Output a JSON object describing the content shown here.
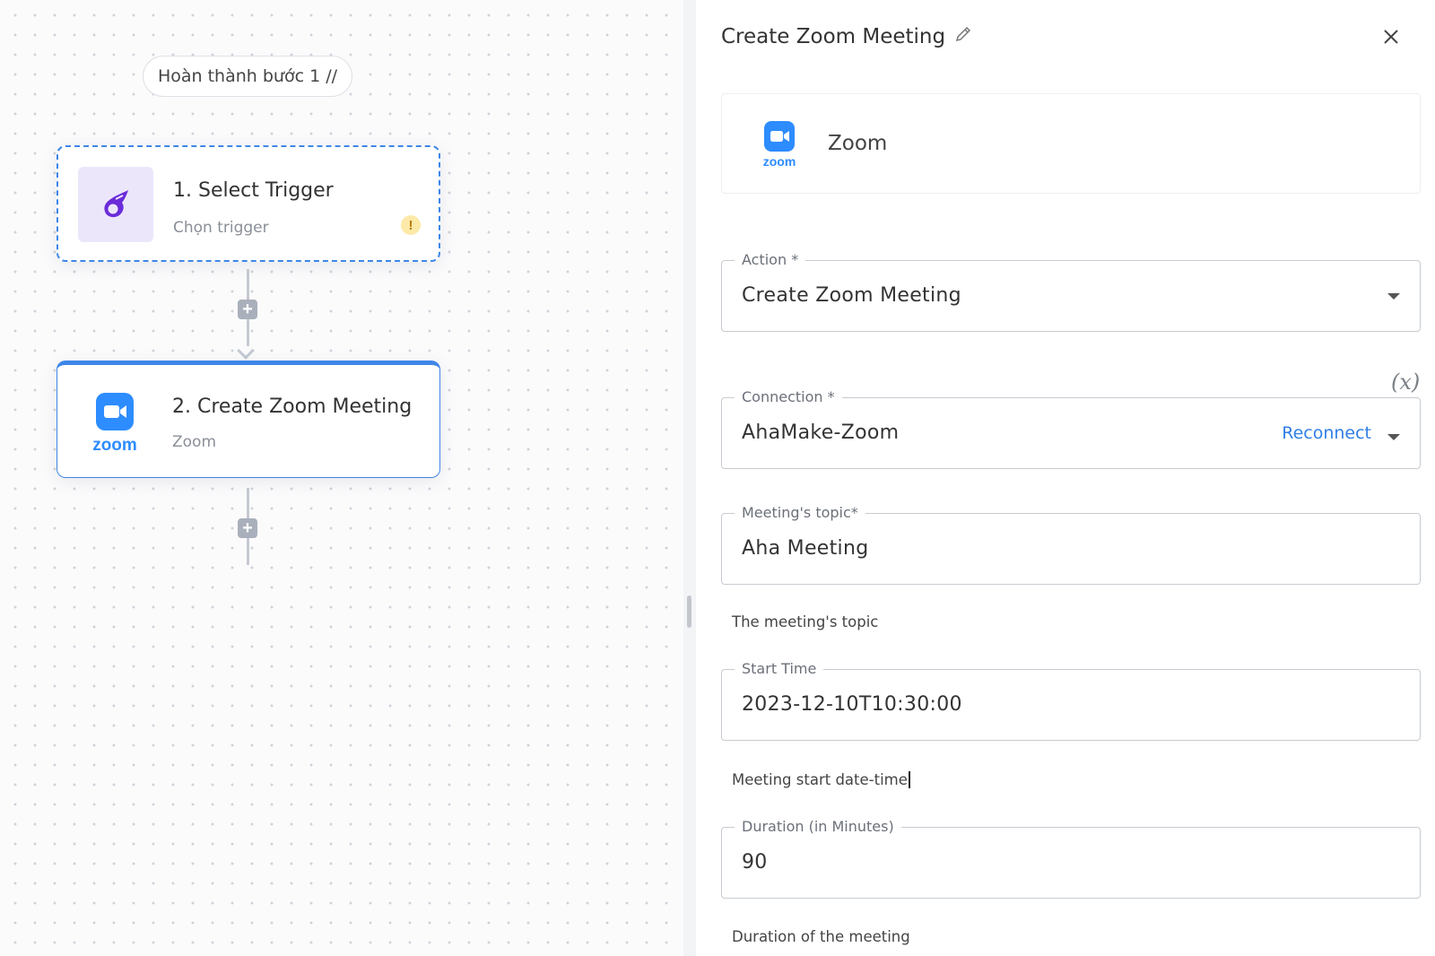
{
  "canvas": {
    "step_pill": "Hoàn thành bước 1 //",
    "nodes": [
      {
        "title": "1. Select Trigger",
        "subtitle": "Chọn trigger",
        "icon": "comet-trigger-icon",
        "status": "warning"
      },
      {
        "title": "2. Create Zoom Meeting",
        "subtitle": "Zoom",
        "icon": "zoom-logo-icon",
        "zoom_wordmark": "zoom"
      }
    ]
  },
  "panel": {
    "title": "Create Zoom Meeting",
    "app": {
      "name": "Zoom",
      "wordmark": "zoom"
    },
    "var_toggle": "(x)",
    "fields": {
      "action": {
        "label": "Action *",
        "value": "Create Zoom Meeting"
      },
      "connection": {
        "label": "Connection *",
        "value": "AhaMake-Zoom",
        "reconnect": "Reconnect"
      },
      "topic": {
        "label": "Meeting's topic*",
        "value": "Aha Meeting",
        "hint": "The meeting's topic"
      },
      "start_time": {
        "label": "Start Time",
        "value": "2023-12-10T10:30:00",
        "hint": "Meeting start date-time"
      },
      "duration": {
        "label": "Duration (in Minutes)",
        "value": "90",
        "hint": "Duration of the meeting"
      }
    }
  },
  "colors": {
    "accent": "#3f86e8",
    "zoom_blue": "#2d8cff",
    "trigger_purple": "#6a2bd9",
    "warning": "#fde9a8"
  }
}
